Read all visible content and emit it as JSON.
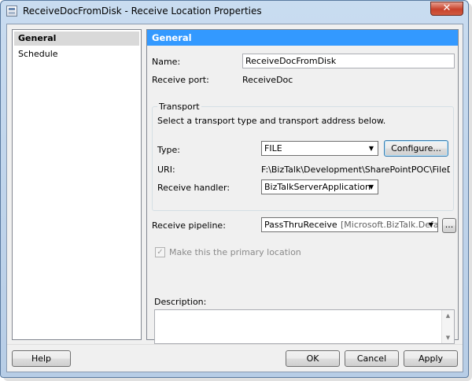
{
  "window": {
    "title": "ReceiveDocFromDisk - Receive Location Properties",
    "close_glyph": "✕"
  },
  "nav": {
    "items": [
      {
        "label": "General",
        "selected": true
      },
      {
        "label": "Schedule",
        "selected": false
      }
    ]
  },
  "general": {
    "header": "General",
    "name_label": "Name:",
    "name_value": "ReceiveDocFromDisk",
    "receive_port_label": "Receive port:",
    "receive_port_value": "ReceiveDoc",
    "transport": {
      "group_title": "Transport",
      "instruction": "Select a transport type and transport address below.",
      "type_label": "Type:",
      "type_value": "FILE",
      "configure_button": "Configure...",
      "uri_label": "URI:",
      "uri_value": "F:\\BizTalk\\Development\\SharePointPOC\\FileDrop\\*.cop",
      "handler_label": "Receive handler:",
      "handler_value": "BizTalkServerApplication"
    },
    "pipeline_label": "Receive pipeline:",
    "pipeline_value": "PassThruReceive",
    "pipeline_assembly": "[Microsoft.BizTalk.Defau",
    "pipeline_browse_button": "...",
    "primary_location_label": "Make this the primary location",
    "primary_location_checked": true,
    "description_label": "Description:",
    "description_value": ""
  },
  "footer": {
    "help_button": "Help",
    "ok_button": "OK",
    "cancel_button": "Cancel",
    "apply_button": "Apply"
  },
  "colors": {
    "header_bg": "#3399ff",
    "selected_nav_bg": "#d9d9d9",
    "close_button": "#c8432c"
  }
}
